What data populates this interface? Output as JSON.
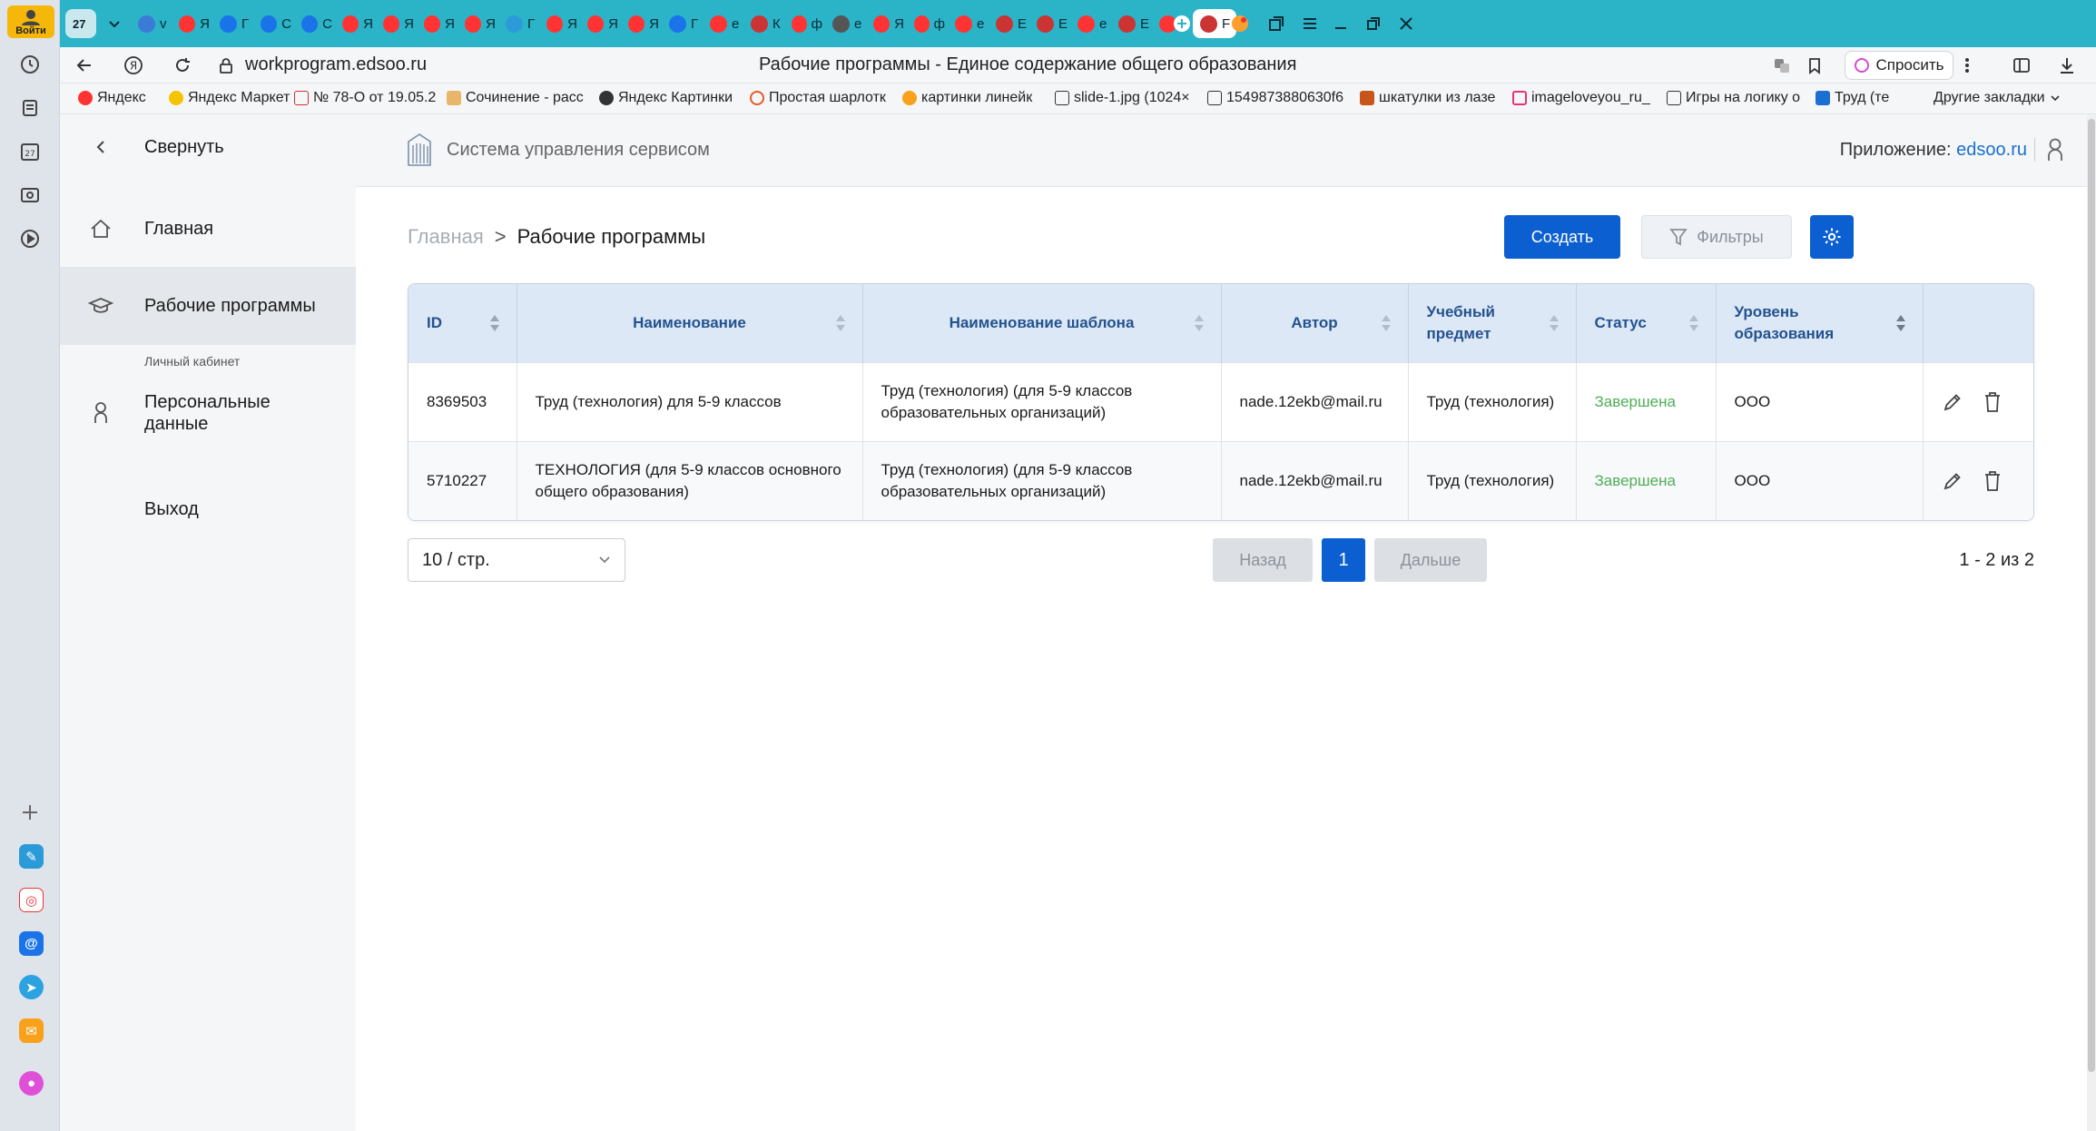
{
  "browser": {
    "login_label": "Войти",
    "url": "workprogram.edsoo.ru",
    "page_title": "Рабочие программы - Единое содержание общего образования",
    "ask_label": "Спросить",
    "tab_count_badge": "27",
    "tabs": [
      {
        "letter": "v",
        "color": "#ffffff",
        "fav": "#3b7bd6"
      },
      {
        "letter": "Я",
        "color": "#ffffff",
        "fav": "#f33"
      },
      {
        "letter": "Г",
        "color": "#ffffff",
        "fav": "#1a73e8"
      },
      {
        "letter": "С",
        "color": "#ffffff",
        "fav": "#1a73e8"
      },
      {
        "letter": "С",
        "color": "#ffffff",
        "fav": "#1a73e8"
      },
      {
        "letter": "Я",
        "color": "#ffffff",
        "fav": "#f33"
      },
      {
        "letter": "Я",
        "color": "#ffffff",
        "fav": "#f33"
      },
      {
        "letter": "Я",
        "color": "#ffffff",
        "fav": "#f33"
      },
      {
        "letter": "Я",
        "color": "#ffffff",
        "fav": "#f33"
      },
      {
        "letter": "Г",
        "color": "#ffffff",
        "fav": "#2a9bd8"
      },
      {
        "letter": "Я",
        "color": "#ffffff",
        "fav": "#f33"
      },
      {
        "letter": "Я",
        "color": "#ffffff",
        "fav": "#f33"
      },
      {
        "letter": "Я",
        "color": "#ffffff",
        "fav": "#f33"
      },
      {
        "letter": "Г",
        "color": "#ffffff",
        "fav": "#1a73e8"
      },
      {
        "letter": "е",
        "color": "#ffffff",
        "fav": "#f33"
      },
      {
        "letter": "К",
        "color": "#ffffff",
        "fav": "#c33"
      },
      {
        "letter": "ф",
        "color": "#ffffff",
        "fav": "#f33"
      },
      {
        "letter": "е",
        "color": "#ffffff",
        "fav": "#555"
      },
      {
        "letter": "Я",
        "color": "#ffffff",
        "fav": "#f33"
      },
      {
        "letter": "ф",
        "color": "#ffffff",
        "fav": "#f33"
      },
      {
        "letter": "е",
        "color": "#ffffff",
        "fav": "#f33"
      },
      {
        "letter": "Е",
        "color": "#ffffff",
        "fav": "#c33"
      },
      {
        "letter": "Е",
        "color": "#ffffff",
        "fav": "#c33"
      },
      {
        "letter": "е",
        "color": "#ffffff",
        "fav": "#f33"
      },
      {
        "letter": "Е",
        "color": "#ffffff",
        "fav": "#c33"
      },
      {
        "letter": "е",
        "color": "#ffffff",
        "fav": "#f33"
      },
      {
        "letter": "F",
        "color": "#ffffff",
        "fav": "#c33"
      }
    ],
    "bookmarks": [
      "Яндекс",
      "Яндекс Маркет",
      "№ 78-О от 19.05.2",
      "Сочинение - расс",
      "Яндекс Картинки",
      "Простая шарлотк",
      "картинки линейк",
      "slide-1.jpg (1024×",
      "1549873880630f6",
      "шкатулки из лазе",
      "imageloveyou_ru_",
      "Игры на логику о",
      "Труд (те",
      "Другие закладки"
    ]
  },
  "sidebar": {
    "collapse": "Свернуть",
    "home": "Главная",
    "programs": "Рабочие программы",
    "cabinet_caption": "Личный кабинет",
    "personal_data": "Персональные данные",
    "logout": "Выход"
  },
  "header": {
    "system_name": "Система управления сервисом",
    "app_label": "Приложение:",
    "app_link": "edsoo.ru"
  },
  "breadcrumb": {
    "home": "Главная",
    "separator": ">",
    "current": "Рабочие программы"
  },
  "toolbar": {
    "create": "Создать",
    "filters": "Фильтры"
  },
  "table": {
    "columns": [
      "ID",
      "Наименование",
      "Наименование шаблона",
      "Автор",
      "Учебный предмет",
      "Статус",
      "Уровень образования"
    ],
    "rows": [
      {
        "id": "8369503",
        "name": "Труд (технология) для 5-9 классов",
        "template": "Труд (технология) (для 5-9 классов образовательных организаций)",
        "author": "nade.12ekb@mail.ru",
        "subject": "Труд (технология)",
        "status": "Завершена",
        "level": "ООО"
      },
      {
        "id": "5710227",
        "name": "ТЕХНОЛОГИЯ (для 5-9 классов основного общего образования)",
        "template": "Труд (технология) (для 5-9 классов образовательных организаций)",
        "author": "nade.12ekb@mail.ru",
        "subject": "Труд (технология)",
        "status": "Завершена",
        "level": "ООО"
      }
    ]
  },
  "pagination": {
    "page_size": "10 / стр.",
    "prev": "Назад",
    "current_page": "1",
    "next": "Дальше",
    "range": "1 - 2 из 2"
  },
  "colors": {
    "primary": "#0b5fd0",
    "status_done": "#4fae57",
    "header_bg": "#dde8f6",
    "tabs_bar": "#2bb3c8"
  }
}
